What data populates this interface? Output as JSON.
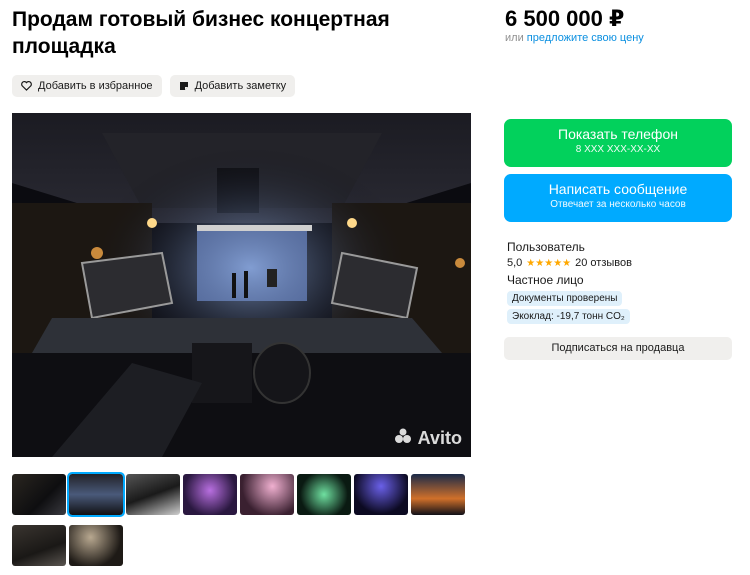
{
  "listing": {
    "title": "Продам готовый бизнес концертная площадка",
    "add_favorite_label": "Добавить в избранное",
    "add_note_label": "Добавить заметку"
  },
  "gallery": {
    "watermark": "Avito",
    "thumbnails_count": 10,
    "active_thumbnail": 2
  },
  "price": {
    "value": "6 500 000 ₽",
    "prefix": "или",
    "offer_link": "предложите свою цену"
  },
  "actions": {
    "show_phone": "Показать телефон",
    "phone_masked": "8 XXX XXX-XX-XX",
    "write_message": "Написать сообщение",
    "reply_time": "Отвечает за несколько часов"
  },
  "seller": {
    "name": "Пользователь",
    "rating": "5,0",
    "stars": "★★★★★",
    "reviews": "20 отзывов",
    "type": "Частное лицо",
    "badge_docs": "Документы проверены",
    "badge_eco": "Экоклад: -19,7 тонн CO₂",
    "subscribe": "Подписаться на продавца"
  },
  "colors": {
    "green": "#02d15c",
    "blue": "#00aaff",
    "badge_bg": "#dff0fb"
  }
}
